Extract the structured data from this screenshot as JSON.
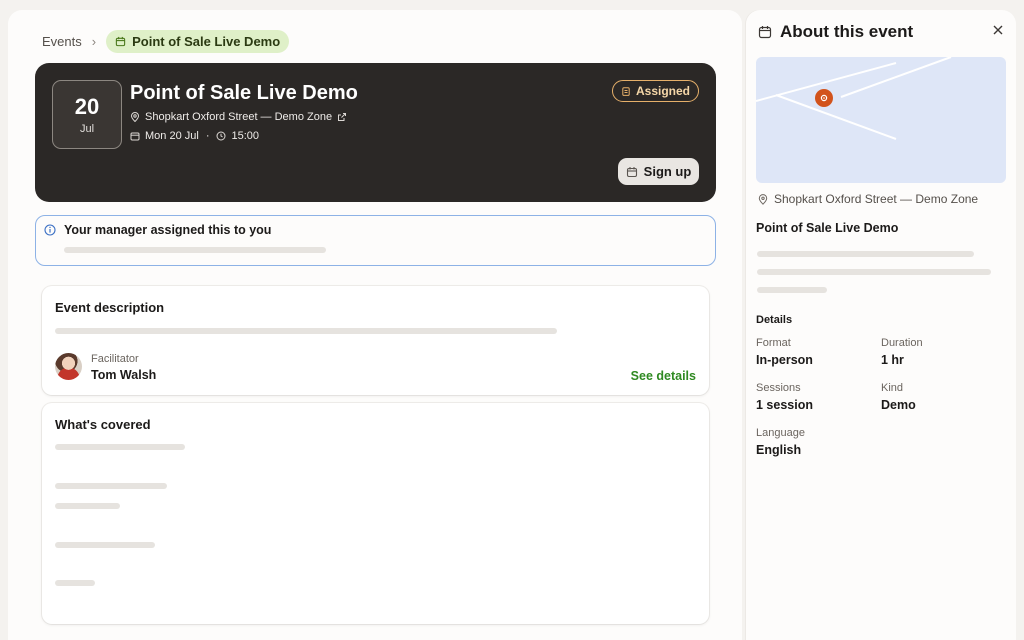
{
  "breadcrumb": {
    "root": "Events",
    "separator": "›",
    "current": "Point of Sale Live Demo"
  },
  "event": {
    "day": "20",
    "month": "Jul",
    "title": "Point of Sale Live Demo",
    "location": "Shopkart Oxford Street — Demo Zone",
    "date": "Mon 20 Jul",
    "dot": "·",
    "time": "15:00",
    "badge": "Assigned",
    "signup_label": "Sign up"
  },
  "notice": {
    "text": "Your manager assigned this to you"
  },
  "description_card": {
    "title": "Event description",
    "facilitator_label": "Facilitator",
    "facilitator_name": "Tom Walsh",
    "see_details": "See details"
  },
  "covered_card": {
    "title": "What's covered"
  },
  "side": {
    "title": "About this event",
    "location": "Shopkart Oxford Street — Demo Zone",
    "event_name": "Point of Sale Live Demo",
    "details_heading": "Details",
    "details": {
      "format_label": "Format",
      "format_value": "In-person",
      "duration_label": "Duration",
      "duration_value": "1 hr",
      "sessions_label": "Sessions",
      "sessions_value": "1 session",
      "kind_label": "Kind",
      "kind_value": "Demo",
      "language_label": "Language",
      "language_value": "English"
    }
  },
  "colors": {
    "accent_green": "#2f8a22",
    "hero_bg": "#2b2826",
    "badge_orange": "#e6b06a",
    "pin_orange": "#d2531c",
    "notice_border": "#8db2e6"
  },
  "icons": [
    "chevron-right-icon",
    "calendar-icon",
    "map-pin-icon",
    "external-link-icon",
    "clock-icon",
    "clipboard-icon",
    "info-icon",
    "close-icon"
  ]
}
